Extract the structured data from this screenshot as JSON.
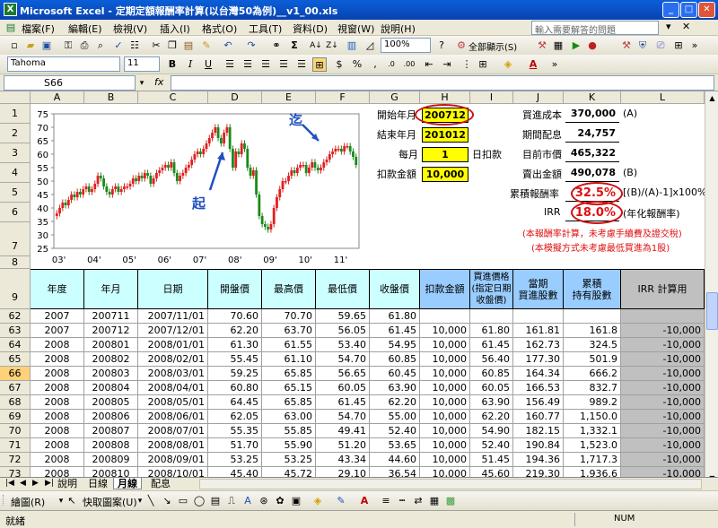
{
  "window": {
    "title": "Microsoft Excel - 定期定額報酬率計算(以台灣50為例)__v1_00.xls",
    "app_icon": "X"
  },
  "menu": [
    "檔案(F)",
    "編輯(E)",
    "檢視(V)",
    "插入(I)",
    "格式(O)",
    "工具(T)",
    "資料(D)",
    "視窗(W)",
    "說明(H)"
  ],
  "help_placeholder": "輸入需要解答的問題",
  "toolbar": {
    "zoom": "100%",
    "display_all": "全部顯示(S)",
    "font": "Tahoma",
    "font_size": "11"
  },
  "formula_bar": {
    "name_box": "S66",
    "fx": "fx",
    "content": ""
  },
  "columns": [
    "A",
    "B",
    "C",
    "D",
    "E",
    "F",
    "G",
    "H",
    "I",
    "J",
    "K",
    "L"
  ],
  "inputs": {
    "start_label": "開始年月",
    "start_value": "200712",
    "end_label": "結束年月",
    "end_value": "201012",
    "day_label": "每月",
    "day_value": "1",
    "day_suffix": "日扣款",
    "amount_label": "扣款金額",
    "amount_value": "10,000"
  },
  "summary": {
    "cost_label": "買進成本",
    "cost_value": "370,000",
    "cost_tag": "(A)",
    "div_label": "期間配息",
    "div_value": "24,757",
    "mkt_label": "目前市價",
    "mkt_value": "465,322",
    "sell_label": "賣出金額",
    "sell_value": "490,078",
    "sell_tag": "(B)",
    "cum_label": "累積報酬率",
    "cum_value": "32.5%",
    "cum_formula": "[(B)/(A)-1]x100%",
    "irr_label": "IRR",
    "irr_value": "18.0%",
    "irr_note": "(年化報酬率)"
  },
  "notes": [
    "(本報酬率計算，未考慮手續費及證交稅)",
    "(本模擬方式未考慮最低買進為1股)"
  ],
  "chart_labels": {
    "start": "起",
    "end": "迄"
  },
  "table_headers": [
    "年度",
    "年月",
    "日期",
    "開盤價",
    "最高價",
    "最低價",
    "收盤價",
    "扣款金額",
    "買進價格\n(指定日期\n收盤價)",
    "當期\n買進股數",
    "累積\n持有股數",
    "IRR 計算用"
  ],
  "row_numbers": [
    "1",
    "2",
    "3",
    "4",
    "5",
    "6",
    "7",
    "8",
    "9",
    "62",
    "63",
    "64",
    "65",
    "66",
    "67",
    "68",
    "69",
    "70",
    "71",
    "72",
    "73"
  ],
  "rows": [
    [
      "2007",
      "200711",
      "2007/11/01",
      "70.60",
      "70.70",
      "59.65",
      "61.80",
      "",
      "",
      "",
      "",
      ""
    ],
    [
      "2007",
      "200712",
      "2007/12/01",
      "62.20",
      "63.70",
      "56.05",
      "61.45",
      "10,000",
      "61.80",
      "161.81",
      "161.8",
      "-10,000"
    ],
    [
      "2008",
      "200801",
      "2008/01/01",
      "61.30",
      "61.55",
      "53.40",
      "54.95",
      "10,000",
      "61.45",
      "162.73",
      "324.5",
      "-10,000"
    ],
    [
      "2008",
      "200802",
      "2008/02/01",
      "55.45",
      "61.10",
      "54.70",
      "60.85",
      "10,000",
      "56.40",
      "177.30",
      "501.9",
      "-10,000"
    ],
    [
      "2008",
      "200803",
      "2008/03/01",
      "59.25",
      "65.85",
      "56.65",
      "60.45",
      "10,000",
      "60.85",
      "164.34",
      "666.2",
      "-10,000"
    ],
    [
      "2008",
      "200804",
      "2008/04/01",
      "60.80",
      "65.15",
      "60.05",
      "63.90",
      "10,000",
      "60.05",
      "166.53",
      "832.7",
      "-10,000"
    ],
    [
      "2008",
      "200805",
      "2008/05/01",
      "64.45",
      "65.85",
      "61.45",
      "62.20",
      "10,000",
      "63.90",
      "156.49",
      "989.2",
      "-10,000"
    ],
    [
      "2008",
      "200806",
      "2008/06/01",
      "62.05",
      "63.00",
      "54.70",
      "55.00",
      "10,000",
      "62.20",
      "160.77",
      "1,150.0",
      "-10,000"
    ],
    [
      "2008",
      "200807",
      "2008/07/01",
      "55.35",
      "55.85",
      "49.41",
      "52.40",
      "10,000",
      "54.90",
      "182.15",
      "1,332.1",
      "-10,000"
    ],
    [
      "2008",
      "200808",
      "2008/08/01",
      "51.70",
      "55.90",
      "51.20",
      "53.65",
      "10,000",
      "52.40",
      "190.84",
      "1,523.0",
      "-10,000"
    ],
    [
      "2008",
      "200809",
      "2008/09/01",
      "53.25",
      "53.25",
      "43.34",
      "44.60",
      "10,000",
      "51.45",
      "194.36",
      "1,717.3",
      "-10,000"
    ],
    [
      "2008",
      "200810",
      "2008/10/01",
      "45.40",
      "45.72",
      "29.10",
      "36.54",
      "10,000",
      "45.60",
      "219.30",
      "1,936.6",
      "-10,000"
    ]
  ],
  "sheet_tabs": [
    "說明",
    "日線",
    "月線",
    "配息"
  ],
  "active_tab": "月線",
  "drawing": {
    "draw_label": "繪圖(R)",
    "shapes_label": "快取圖案(U)"
  },
  "status": {
    "left": "就緒",
    "num": "NUM"
  },
  "chart_data": {
    "type": "candlestick",
    "title": "",
    "x_ticks": [
      "03'",
      "04'",
      "05'",
      "06'",
      "07'",
      "08'",
      "09'",
      "10'",
      "11'"
    ],
    "y_ticks": [
      75,
      70,
      65,
      60,
      55,
      50,
      45,
      40,
      35,
      30,
      25
    ],
    "ylim": [
      25,
      75
    ],
    "colors": {
      "up": "#e02020",
      "down": "#1a8a1a"
    },
    "years": [
      {
        "year": "03'",
        "close": [
          38,
          40,
          42,
          41,
          43,
          45,
          44,
          46,
          45,
          47,
          48,
          46
        ]
      },
      {
        "year": "04'",
        "close": [
          47,
          49,
          52,
          51,
          48,
          46,
          45,
          47,
          48,
          46,
          47,
          48
        ]
      },
      {
        "year": "05'",
        "close": [
          48,
          49,
          51,
          50,
          52,
          51,
          53,
          52,
          49,
          51,
          53,
          54
        ]
      },
      {
        "year": "06'",
        "close": [
          55,
          56,
          55,
          57,
          53,
          50,
          52,
          53,
          55,
          56,
          58,
          60
        ]
      },
      {
        "year": "07'",
        "close": [
          61,
          60,
          62,
          64,
          66,
          68,
          70,
          66,
          64,
          68,
          70,
          62
        ]
      },
      {
        "year": "08'",
        "close": [
          55,
          61,
          60,
          64,
          62,
          55,
          52,
          54,
          45,
          37,
          34,
          33
        ]
      },
      {
        "year": "09'",
        "close": [
          32,
          34,
          40,
          44,
          47,
          50,
          50,
          52,
          54,
          53,
          55,
          56
        ]
      },
      {
        "year": "10'",
        "close": [
          56,
          53,
          55,
          57,
          55,
          54,
          55,
          57,
          58,
          60,
          61,
          62
        ]
      },
      {
        "year": "11'",
        "close": [
          62,
          61,
          63,
          63,
          61,
          59,
          56
        ]
      }
    ]
  }
}
